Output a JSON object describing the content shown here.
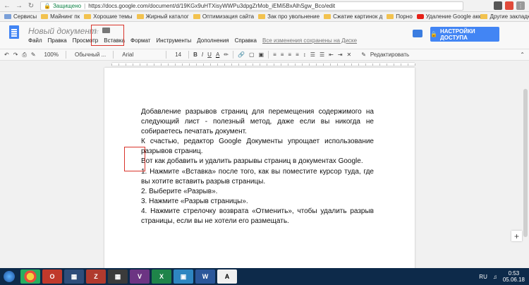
{
  "browser": {
    "secure_label": "Защищено",
    "url": "https://docs.google.com/document/d/19KGx9uHTXisyWWPu3dpgZrMob_iEMi5BxAlhSgw_Bco/edit"
  },
  "bookmarks": [
    "Сервисы",
    "Майнинг пк",
    "Хорошие темы",
    "Жирный каталог",
    "Оптимизация сайта",
    "Зак про увольнение",
    "Сжатие картинок д",
    "Порно",
    "Удаление Google акк"
  ],
  "bookmarks_other": "Другие закладки",
  "doc": {
    "title": "Новый документ",
    "menu": [
      "Файл",
      "Правка",
      "Просмотр",
      "Вставка",
      "Формат",
      "Инструменты",
      "Дополнения",
      "Справка"
    ],
    "saved_status": "Все изменения сохранены на Диске",
    "share_label": "НАСТРОЙКИ ДОСТУПА"
  },
  "toolbar": {
    "zoom": "100%",
    "style": "Обычный ...",
    "font": "Arial",
    "size": "14",
    "mode": "Редактировать"
  },
  "content": {
    "p1": "Добавление разрывов страниц для перемещения содержимого на следующий лист - полезный метод, даже если вы никогда не собираетесь печатать документ.",
    "p2": "К счастью, редактор Google Документы упрощает использование разрывов страниц.",
    "p3": "Вот как добавить и удалить разрывы страниц в документах Google.",
    "p4": "1. Нажмите «Вставка» после того, как вы поместите курсор туда, где вы хотите вставить разрыв страницы.",
    "p5": "2. Выберите «Разрыв».",
    "p6": "3.  Нажмите «Разрыв страницы».",
    "p7": "4. Нажмите стрелочку возврата «Отменить», чтобы удалить разрыв страницы, если вы не хотели его размещать."
  },
  "taskbar": {
    "lang": "RU",
    "time": "0:53",
    "date": "05.06.18"
  }
}
